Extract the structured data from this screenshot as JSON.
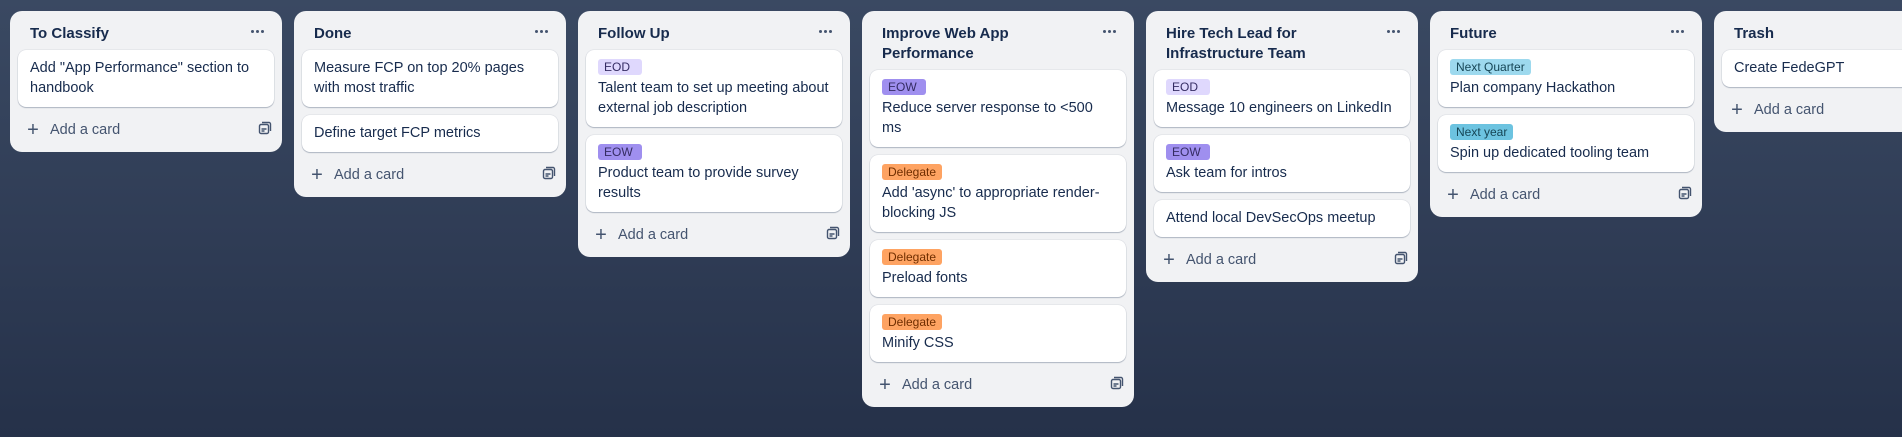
{
  "board": {
    "add_card_label": "Add a card",
    "lists": [
      {
        "title": "To Classify",
        "cards": [
          {
            "title": "Add \"App Performance\" section to handbook"
          }
        ]
      },
      {
        "title": "Done",
        "cards": [
          {
            "title": "Measure FCP on top 20% pages with most traffic"
          },
          {
            "title": "Define target FCP metrics"
          }
        ]
      },
      {
        "title": "Follow Up",
        "cards": [
          {
            "label": {
              "text": "EOD",
              "bg": "#dfd8fd",
              "fg": "#352c63"
            },
            "title": "Talent team to set up meeting about external job description"
          },
          {
            "label": {
              "text": "EOW",
              "bg": "#9f8fef",
              "fg": "#352c63"
            },
            "title": "Product team to provide survey results"
          }
        ]
      },
      {
        "title": "Improve Web App Performance",
        "cards": [
          {
            "label": {
              "text": "EOW",
              "bg": "#9f8fef",
              "fg": "#352c63"
            },
            "title": "Reduce server response to <500 ms"
          },
          {
            "label": {
              "text": "Delegate",
              "bg": "#fea362",
              "fg": "#702e00"
            },
            "title": "Add 'async' to appropriate render-blocking JS"
          },
          {
            "label": {
              "text": "Delegate",
              "bg": "#fea362",
              "fg": "#702e00"
            },
            "title": "Preload fonts"
          },
          {
            "label": {
              "text": "Delegate",
              "bg": "#fea362",
              "fg": "#702e00"
            },
            "title": "Minify CSS"
          }
        ]
      },
      {
        "title": "Hire Tech Lead for Infrastructure Team",
        "cards": [
          {
            "label": {
              "text": "EOD",
              "bg": "#dfd8fd",
              "fg": "#352c63"
            },
            "title": "Message 10 engineers on LinkedIn"
          },
          {
            "label": {
              "text": "EOW",
              "bg": "#9f8fef",
              "fg": "#352c63"
            },
            "title": "Ask team for intros"
          },
          {
            "title": "Attend local DevSecOps meetup"
          }
        ]
      },
      {
        "title": "Future",
        "cards": [
          {
            "label": {
              "text": "Next Quarter",
              "bg": "#9dd9ee",
              "fg": "#164555"
            },
            "title": "Plan company Hackathon"
          },
          {
            "label": {
              "text": "Next year",
              "bg": "#6cc3e0",
              "fg": "#164555"
            },
            "title": "Spin up dedicated tooling team"
          }
        ]
      },
      {
        "title": "Trash",
        "show_menu": false,
        "show_template": false,
        "cards": [
          {
            "title": "Create FedeGPT"
          }
        ]
      }
    ]
  }
}
